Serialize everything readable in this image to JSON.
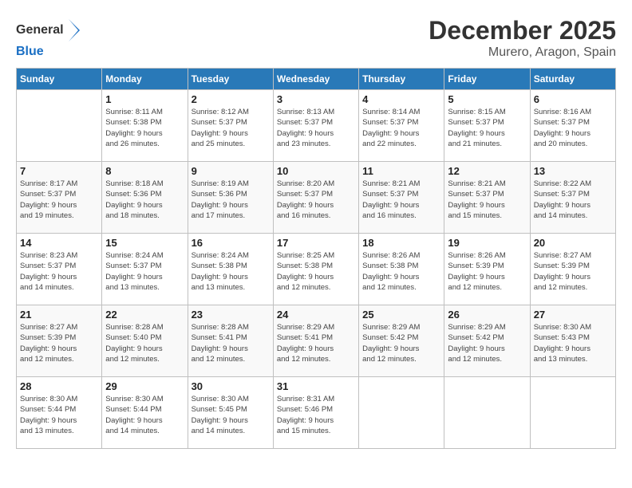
{
  "header": {
    "logo_general": "General",
    "logo_blue": "Blue",
    "month": "December 2025",
    "location": "Murero, Aragon, Spain"
  },
  "weekdays": [
    "Sunday",
    "Monday",
    "Tuesday",
    "Wednesday",
    "Thursday",
    "Friday",
    "Saturday"
  ],
  "weeks": [
    [
      {
        "day": "",
        "info": ""
      },
      {
        "day": "1",
        "info": "Sunrise: 8:11 AM\nSunset: 5:38 PM\nDaylight: 9 hours\nand 26 minutes."
      },
      {
        "day": "2",
        "info": "Sunrise: 8:12 AM\nSunset: 5:37 PM\nDaylight: 9 hours\nand 25 minutes."
      },
      {
        "day": "3",
        "info": "Sunrise: 8:13 AM\nSunset: 5:37 PM\nDaylight: 9 hours\nand 23 minutes."
      },
      {
        "day": "4",
        "info": "Sunrise: 8:14 AM\nSunset: 5:37 PM\nDaylight: 9 hours\nand 22 minutes."
      },
      {
        "day": "5",
        "info": "Sunrise: 8:15 AM\nSunset: 5:37 PM\nDaylight: 9 hours\nand 21 minutes."
      },
      {
        "day": "6",
        "info": "Sunrise: 8:16 AM\nSunset: 5:37 PM\nDaylight: 9 hours\nand 20 minutes."
      }
    ],
    [
      {
        "day": "7",
        "info": "Sunrise: 8:17 AM\nSunset: 5:37 PM\nDaylight: 9 hours\nand 19 minutes."
      },
      {
        "day": "8",
        "info": "Sunrise: 8:18 AM\nSunset: 5:36 PM\nDaylight: 9 hours\nand 18 minutes."
      },
      {
        "day": "9",
        "info": "Sunrise: 8:19 AM\nSunset: 5:36 PM\nDaylight: 9 hours\nand 17 minutes."
      },
      {
        "day": "10",
        "info": "Sunrise: 8:20 AM\nSunset: 5:37 PM\nDaylight: 9 hours\nand 16 minutes."
      },
      {
        "day": "11",
        "info": "Sunrise: 8:21 AM\nSunset: 5:37 PM\nDaylight: 9 hours\nand 16 minutes."
      },
      {
        "day": "12",
        "info": "Sunrise: 8:21 AM\nSunset: 5:37 PM\nDaylight: 9 hours\nand 15 minutes."
      },
      {
        "day": "13",
        "info": "Sunrise: 8:22 AM\nSunset: 5:37 PM\nDaylight: 9 hours\nand 14 minutes."
      }
    ],
    [
      {
        "day": "14",
        "info": "Sunrise: 8:23 AM\nSunset: 5:37 PM\nDaylight: 9 hours\nand 14 minutes."
      },
      {
        "day": "15",
        "info": "Sunrise: 8:24 AM\nSunset: 5:37 PM\nDaylight: 9 hours\nand 13 minutes."
      },
      {
        "day": "16",
        "info": "Sunrise: 8:24 AM\nSunset: 5:38 PM\nDaylight: 9 hours\nand 13 minutes."
      },
      {
        "day": "17",
        "info": "Sunrise: 8:25 AM\nSunset: 5:38 PM\nDaylight: 9 hours\nand 12 minutes."
      },
      {
        "day": "18",
        "info": "Sunrise: 8:26 AM\nSunset: 5:38 PM\nDaylight: 9 hours\nand 12 minutes."
      },
      {
        "day": "19",
        "info": "Sunrise: 8:26 AM\nSunset: 5:39 PM\nDaylight: 9 hours\nand 12 minutes."
      },
      {
        "day": "20",
        "info": "Sunrise: 8:27 AM\nSunset: 5:39 PM\nDaylight: 9 hours\nand 12 minutes."
      }
    ],
    [
      {
        "day": "21",
        "info": "Sunrise: 8:27 AM\nSunset: 5:39 PM\nDaylight: 9 hours\nand 12 minutes."
      },
      {
        "day": "22",
        "info": "Sunrise: 8:28 AM\nSunset: 5:40 PM\nDaylight: 9 hours\nand 12 minutes."
      },
      {
        "day": "23",
        "info": "Sunrise: 8:28 AM\nSunset: 5:41 PM\nDaylight: 9 hours\nand 12 minutes."
      },
      {
        "day": "24",
        "info": "Sunrise: 8:29 AM\nSunset: 5:41 PM\nDaylight: 9 hours\nand 12 minutes."
      },
      {
        "day": "25",
        "info": "Sunrise: 8:29 AM\nSunset: 5:42 PM\nDaylight: 9 hours\nand 12 minutes."
      },
      {
        "day": "26",
        "info": "Sunrise: 8:29 AM\nSunset: 5:42 PM\nDaylight: 9 hours\nand 12 minutes."
      },
      {
        "day": "27",
        "info": "Sunrise: 8:30 AM\nSunset: 5:43 PM\nDaylight: 9 hours\nand 13 minutes."
      }
    ],
    [
      {
        "day": "28",
        "info": "Sunrise: 8:30 AM\nSunset: 5:44 PM\nDaylight: 9 hours\nand 13 minutes."
      },
      {
        "day": "29",
        "info": "Sunrise: 8:30 AM\nSunset: 5:44 PM\nDaylight: 9 hours\nand 14 minutes."
      },
      {
        "day": "30",
        "info": "Sunrise: 8:30 AM\nSunset: 5:45 PM\nDaylight: 9 hours\nand 14 minutes."
      },
      {
        "day": "31",
        "info": "Sunrise: 8:31 AM\nSunset: 5:46 PM\nDaylight: 9 hours\nand 15 minutes."
      },
      {
        "day": "",
        "info": ""
      },
      {
        "day": "",
        "info": ""
      },
      {
        "day": "",
        "info": ""
      }
    ]
  ]
}
